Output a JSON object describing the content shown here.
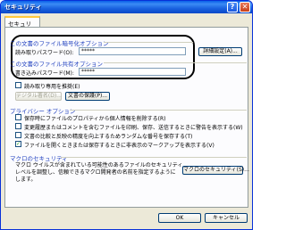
{
  "window": {
    "title": "セキュリティ",
    "help": "?",
    "close": "✕"
  },
  "tab": {
    "label": "セキュリティ"
  },
  "open_group": {
    "title": "この文書のファイル暗号化オプション",
    "password_label": "読み取りパスワード(O):",
    "password_value": "*****",
    "advanced_button": "詳細設定(A)..."
  },
  "share_group": {
    "title": "この文書のファイル共有オプション",
    "password_label": "書き込みパスワード(M):",
    "password_value": "*****",
    "readonly_label": "読み取り専用を推奨(E)",
    "signature_button": "デジタル署名(D)...",
    "protect_button": "文書の保護(P)..."
  },
  "privacy": {
    "title": "プライバシー オプション",
    "options": [
      {
        "label": "保存時にファイルのプロパティから個人情報を削除する(R)",
        "checked": false
      },
      {
        "label": "変更履歴またはコメントを含むファイルを印刷、保存、送信するときに警告を表示する(W)",
        "checked": false
      },
      {
        "label": "文書の比較と反映の精度を向上するためランダムな番号を保存する(T)",
        "checked": false
      },
      {
        "label": "ファイルを開くときまたは保存するときに非表示のマークアップを表示する(V)",
        "checked": true
      }
    ]
  },
  "macro": {
    "title": "マクロのセキュリティ",
    "description": "マクロ ウイルスが含まれている可能性のあるファイルのセキュリティ\nレベルを調整し、信頼できるマクロ開発者の名前を指定するように\nします。",
    "button": "マクロのセキュリティ(S)..."
  },
  "footer": {
    "ok": "OK",
    "cancel": "キャンセル"
  }
}
